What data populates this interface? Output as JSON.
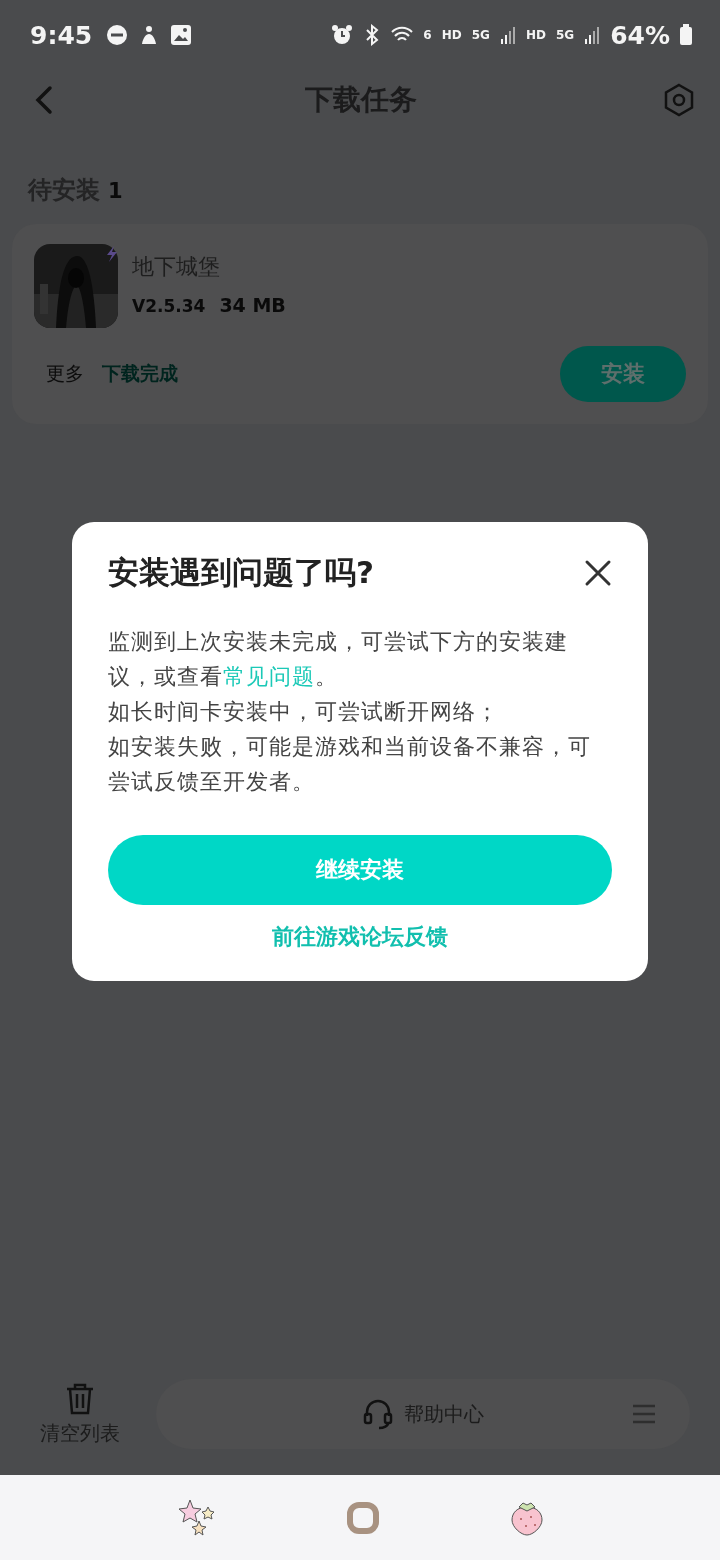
{
  "status_bar": {
    "time": "9:45",
    "wifi_label": "6",
    "network_labels": [
      "HD",
      "5G",
      "HD",
      "5G"
    ],
    "battery": "64%"
  },
  "header": {
    "title": "下载任务"
  },
  "section": {
    "title": "待安装",
    "count": "1"
  },
  "tasks": [
    {
      "name": "地下城堡",
      "version": "V2.5.34",
      "size": "34 MB",
      "more": "更多",
      "status": "下载完成",
      "action": "安装"
    }
  ],
  "bottom_bar": {
    "clear": "清空列表",
    "help": "帮助中心"
  },
  "dialog": {
    "title": "安装遇到问题了吗?",
    "paragraphs": [
      {
        "parts": [
          {
            "text": "监测到上次安装未完成，可尝试下方的安装建议，或查看",
            "link": false
          },
          {
            "text": "常见问题",
            "link": true
          },
          {
            "text": "。",
            "link": false
          }
        ]
      },
      {
        "parts": [
          {
            "text": "如长时间卡安装中，可尝试断开网络；",
            "link": false
          }
        ]
      },
      {
        "parts": [
          {
            "text": "如安装失败，可能是游戏和当前设备不兼容，可尝试反馈至开发者。",
            "link": false
          }
        ]
      }
    ],
    "primary": "继续安装",
    "secondary": "前往游戏论坛反馈"
  }
}
